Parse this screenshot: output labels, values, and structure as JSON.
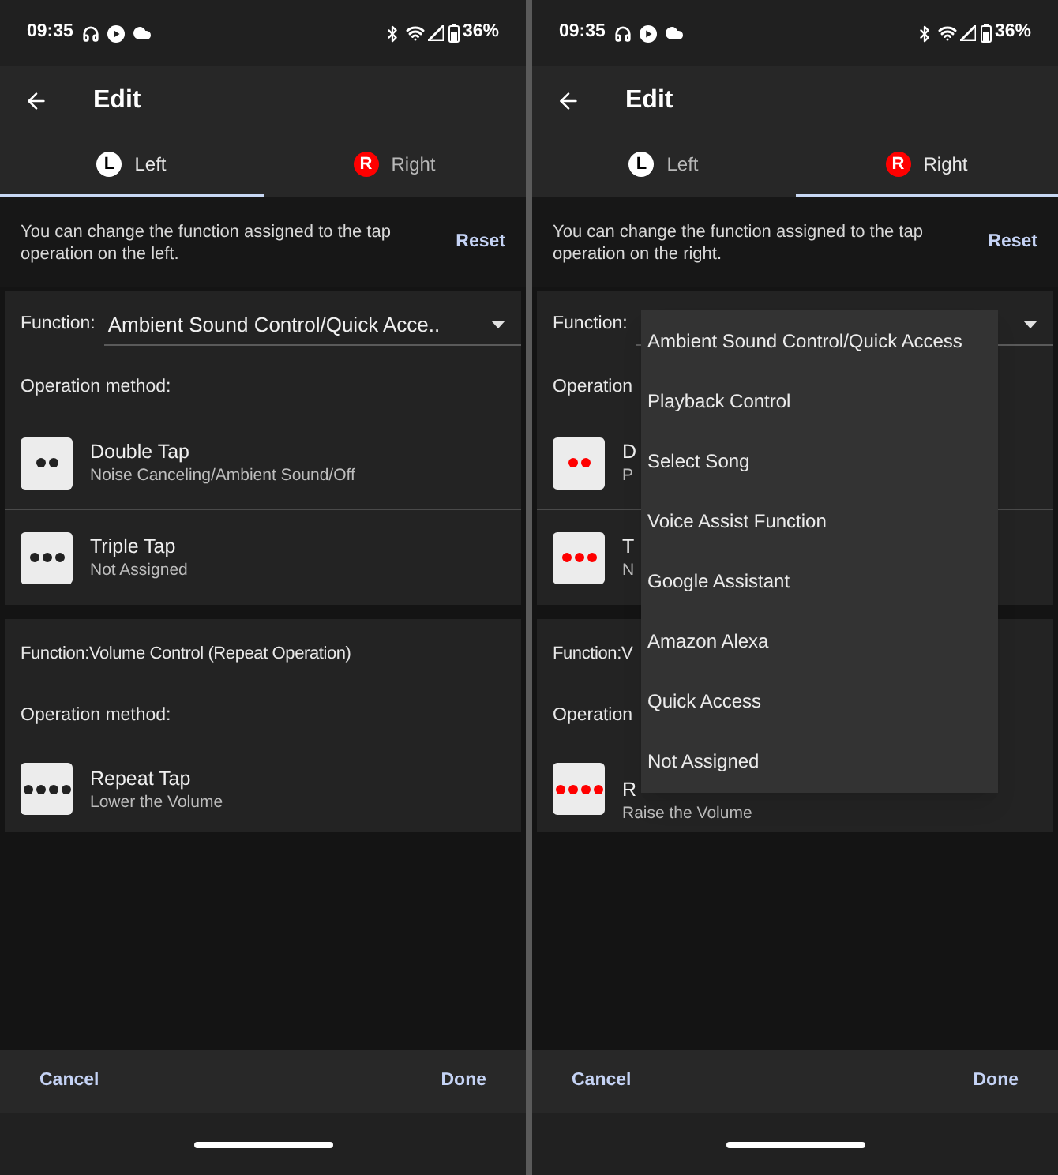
{
  "screens": [
    {
      "status_bar": {
        "time": "09:35",
        "battery": "36%"
      },
      "title": "Edit",
      "color": "#222222",
      "tabs": [
        {
          "letter": "L",
          "label": "Left",
          "selected": true,
          "color": "#ffffff"
        },
        {
          "letter": "R",
          "label": "Right",
          "selected": false,
          "color": "#ff0000"
        }
      ],
      "info": "You can change the function assigned to the tap operation on the left.",
      "reset": "Reset",
      "function": {
        "label": "Function:",
        "value": "Ambient Sound Control/Quick Acce.."
      },
      "method_label": "Operation method:",
      "taps": [
        {
          "kind": "double",
          "name": "Double Tap",
          "description": "Noise Canceling/Ambient Sound/Off"
        },
        {
          "kind": "triple",
          "name": "Triple Tap",
          "description": "Not Assigned"
        }
      ],
      "function2": "Function:Volume Control (Repeat Operation)",
      "method_label2": "Operation method:",
      "repeat_tap": {
        "kind": "repeat",
        "name": "Repeat Tap",
        "description": "Lower the Volume"
      },
      "footer": {
        "cancel": "Cancel",
        "done": "Done"
      }
    },
    {
      "status_bar": {
        "time": "09:35",
        "battery": "36%"
      },
      "title": "Edit",
      "color": "#ff0000",
      "tabs": [
        {
          "letter": "L",
          "label": "Left",
          "selected": false,
          "color": "#ffffff"
        },
        {
          "letter": "R",
          "label": "Right",
          "selected": true,
          "color": "#ff0000"
        }
      ],
      "info": "You can change the function assigned to the tap operation on the right.",
      "reset": "Reset",
      "function": {
        "label": "Function:"
      },
      "method_label": "Operation",
      "taps": [
        {
          "kind": "double",
          "name": "D",
          "description": "P"
        },
        {
          "kind": "triple",
          "name": "T",
          "description": "N"
        }
      ],
      "function2": "Function:V",
      "method_label2": "Operation",
      "repeat_tap": {
        "kind": "repeat",
        "name": "R",
        "description": "Raise the Volume"
      },
      "footer": {
        "cancel": "Cancel",
        "done": "Done"
      },
      "menu": {
        "items": [
          "Ambient Sound Control/Quick Access",
          "Playback Control",
          "Select Song",
          "Voice Assist Function",
          "Google Assistant",
          "Amazon Alexa",
          "Quick Access",
          "Not Assigned"
        ]
      }
    }
  ]
}
